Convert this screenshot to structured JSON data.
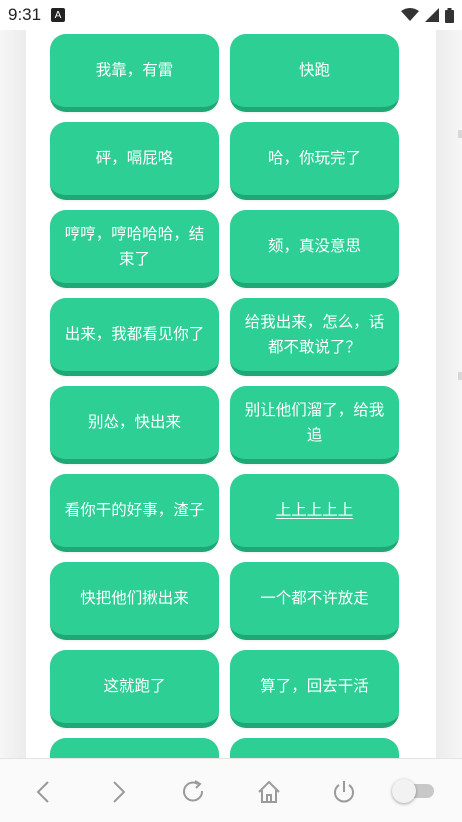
{
  "status_bar": {
    "time": "9:31",
    "notification_icon": "a-letter-icon",
    "signal_icons": [
      "wifi-icon",
      "cellular-signal-icon",
      "battery-icon"
    ]
  },
  "buttons": [
    {
      "label": "我靠，有雷"
    },
    {
      "label": "快跑"
    },
    {
      "label": "砰，嗝屁咯"
    },
    {
      "label": "哈，你玩完了"
    },
    {
      "label": "哼哼，哼哈哈哈，结束了"
    },
    {
      "label": "颏，真没意思"
    },
    {
      "label": "出来，我都看见你了"
    },
    {
      "label": "给我出来，怎么，话都不敢说了？"
    },
    {
      "label": "别怂，快出来"
    },
    {
      "label": "别让他们溜了，给我追"
    },
    {
      "label": "看你干的好事，渣子"
    },
    {
      "label": "上上上上上"
    },
    {
      "label": "快把他们揪出来"
    },
    {
      "label": "一个都不许放走"
    },
    {
      "label": "这就跑了"
    },
    {
      "label": "算了，回去干活"
    },
    {
      "label": ""
    },
    {
      "label": ""
    }
  ],
  "bottom_nav": {
    "items": [
      "back-icon",
      "forward-icon",
      "refresh-icon",
      "home-icon",
      "power-icon",
      "toggle-switch"
    ]
  },
  "colors": {
    "button": "#2ecf94",
    "button_shadow": "#1fa876",
    "background": "#ffffff"
  }
}
